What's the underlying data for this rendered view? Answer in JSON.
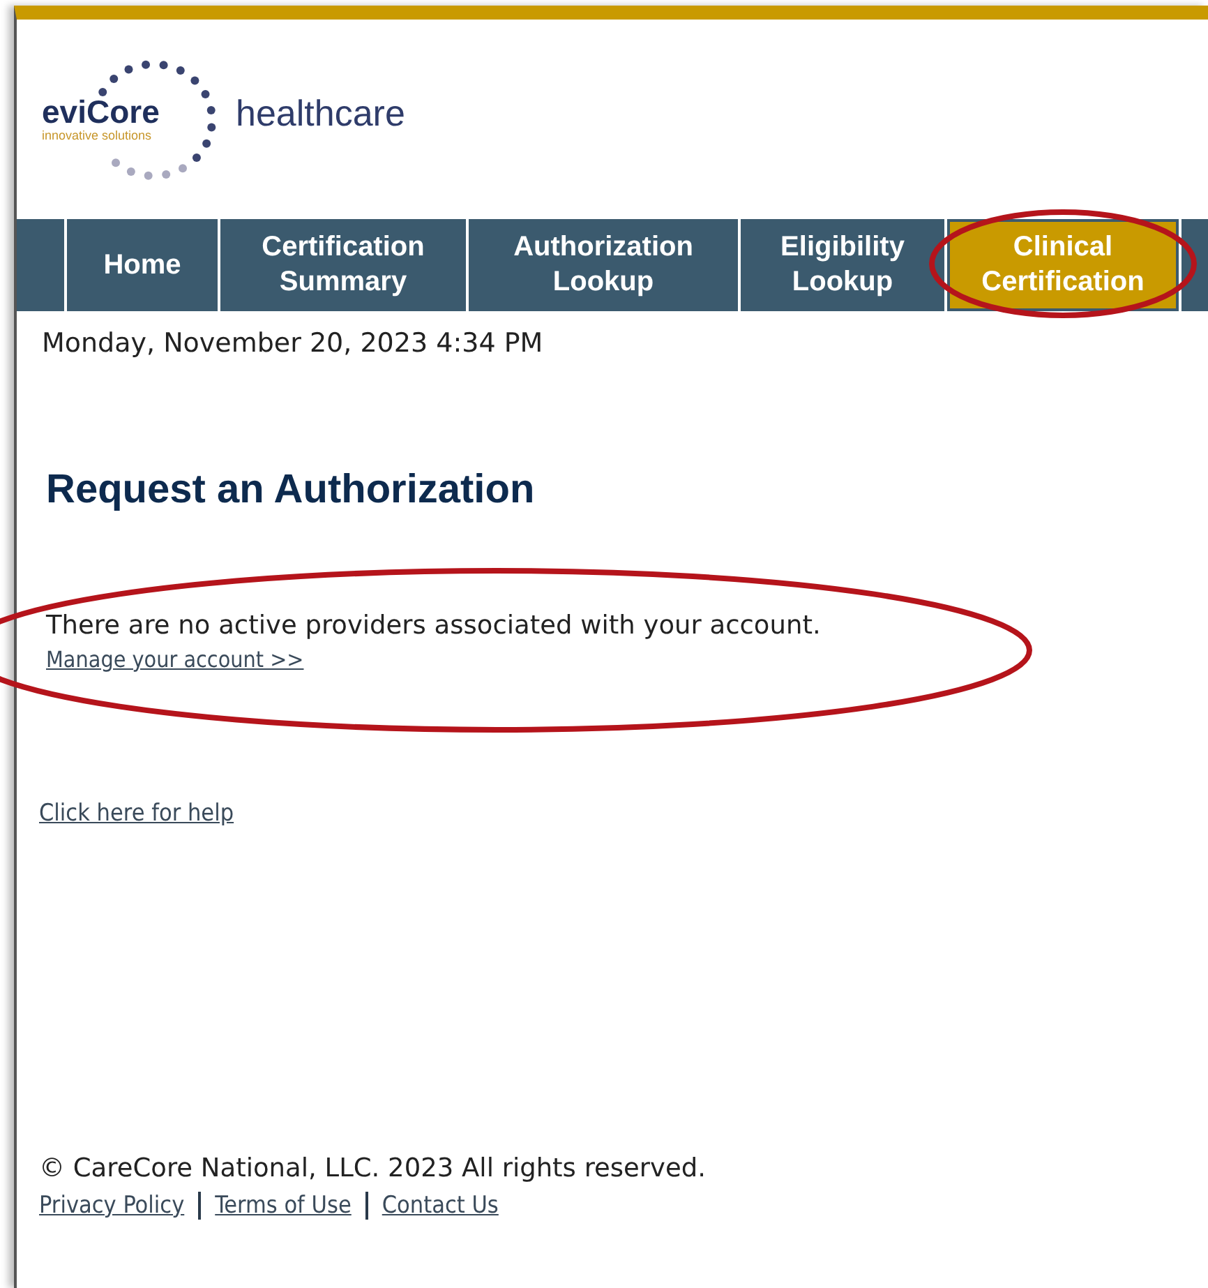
{
  "logo": {
    "brand": "eviCore",
    "tagline": "innovative solutions",
    "suffix": "healthcare"
  },
  "nav": {
    "tabs": [
      {
        "label": "Home",
        "selected": false
      },
      {
        "label": "Certification Summary",
        "selected": false
      },
      {
        "label": "Authorization Lookup",
        "selected": false
      },
      {
        "label": "Eligibility Lookup",
        "selected": false
      },
      {
        "label": "Clinical Certification",
        "selected": true
      }
    ]
  },
  "date": "Monday, November 20, 2023 4:34 PM",
  "heading": "Request an Authorization",
  "message": "There are no active providers associated with your account.",
  "manage_link": "Manage your account >>",
  "help_link": "Click here for help",
  "footer": {
    "copyright": "© CareCore National, LLC. 2023 All rights reserved.",
    "links": [
      "Privacy Policy",
      "Terms of Use",
      "Contact Us"
    ]
  }
}
